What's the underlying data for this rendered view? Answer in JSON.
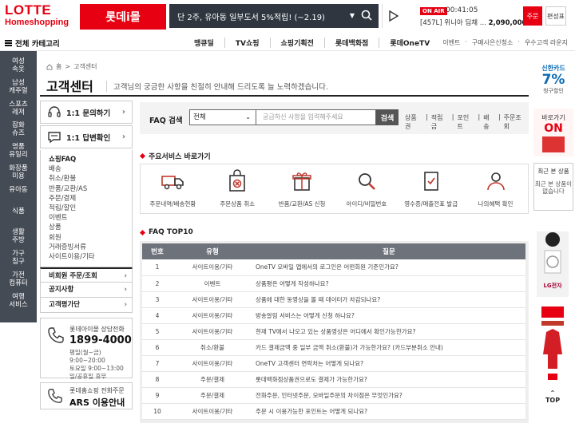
{
  "header": {
    "logo_line1": "LOTTE",
    "logo_line2": "Homeshopping",
    "mall_label": "롯데i몰",
    "promo_text": "단 2주, 유아동 일부도서 5%적립! (~2.19)",
    "onair_badge": "ON AIR",
    "onair_time": "00:41:05",
    "onair_product_prefix": "[457L] 위니아 딤채 ...",
    "onair_price": "2,090,000원",
    "order_label": "주문",
    "tv_label": "편성표"
  },
  "nav": {
    "category_all": "전체 카테고리",
    "links": [
      "맹큐딜",
      "TV쇼핑",
      "쇼핑기획전",
      "롯데백화점",
      "롯데OneTV"
    ],
    "util": [
      "이벤트",
      "·",
      "구매사은신청소",
      "·",
      "우수고객 라운지"
    ]
  },
  "sidecat": [
    "여성\n속옷",
    "남성\n캐주얼",
    "스포츠\n레저",
    "잡화\n슈즈",
    "명품\n유일리",
    "화장품\n미용",
    "유아동",
    "식품",
    "생활\n주방",
    "가구\n침구",
    "가전\n컴퓨터",
    "여행\n서비스"
  ],
  "breadcrumb": {
    "home": "홈",
    "sep": ">",
    "current": "고객센터"
  },
  "page": {
    "title": "고객센터",
    "desc": "고객님의 궁금한 사항을 친절히 안내해 드리도록 늘 노력하겠습니다."
  },
  "left_menu": {
    "inquiry": "1:1 문의하기",
    "answer": "1:1 답변확인",
    "sub_items": [
      "쇼핑FAQ",
      "배송",
      "취소/환불",
      "반품/교환/AS",
      "주문/결제",
      "적립/할인",
      "이벤트",
      "상품",
      "회원",
      "거래증빙서류",
      "사이트이용/기타"
    ],
    "rows": [
      "비회원 주문/조회",
      "공지사항",
      "고객평가단"
    ],
    "call": {
      "label": "롯데아이몰 상담전화",
      "number": "1899-4000",
      "hours1": "평일(월~금) 9:00~20:00",
      "hours2": "토요일 9:00~13:00",
      "hours3": "일/공휴일 휴무"
    },
    "ars": {
      "label": "롯데홈쇼핑 전화주문",
      "text": "ARS 이용안내"
    }
  },
  "faq_search": {
    "label": "FAQ 검색",
    "select_value": "전체",
    "placeholder": "궁금하신 사항을 입력해주세요",
    "button": "검색",
    "keywords": [
      "상품권",
      "|",
      "적립금",
      "|",
      "포인트",
      "|",
      "배송",
      "|",
      "주문조회"
    ]
  },
  "services": {
    "title": "주요서비스 바로가기",
    "items": [
      {
        "label": "주문내역/배송현황",
        "icon": "truck-icon"
      },
      {
        "label": "주문상품 취소",
        "icon": "cancel-bag-icon"
      },
      {
        "label": "반품/교환/AS 신청",
        "icon": "gift-return-icon"
      },
      {
        "label": "아이디/비밀번호",
        "icon": "search-icon"
      },
      {
        "label": "영수증/매출전표 발급",
        "icon": "receipt-icon"
      },
      {
        "label": "나의혜택 확인",
        "icon": "person-icon"
      }
    ]
  },
  "faq_top": {
    "title": "FAQ TOP10",
    "headers": [
      "번호",
      "유형",
      "질문"
    ],
    "rows": [
      [
        "1",
        "사이트이용/기타",
        "OneTV 모바일 앱에서의 로그인은 어떤회원 기준인가요?"
      ],
      [
        "2",
        "이벤트",
        "상품평은 어떻게 작성하나요?"
      ],
      [
        "3",
        "사이트이용/기타",
        "상품에 대한 동영상을 볼 때 데이터가 차감되나요?"
      ],
      [
        "4",
        "사이트이용/기타",
        "방송알림 서비스는 어떻게 신청 하나요?"
      ],
      [
        "5",
        "사이트이용/기타",
        "현재 TV에서 나오고 있는 상품영상은 어디에서 확인가능한가요?"
      ],
      [
        "6",
        "취소/환불",
        "카드 결제금액 중 일부 금액 취소(환불)가 가능한가요? (카드부분취소 안내)"
      ],
      [
        "7",
        "사이트이용/기타",
        "OneTV 고객센터 연락처는 어떻게 되나요?"
      ],
      [
        "8",
        "주문/결제",
        "롯데백화점상품권으로도 결제가 가능한가요?"
      ],
      [
        "9",
        "주문/결제",
        "전화주문, 인터넷주문, 모바일주문의 차이점은 무엇인가요?"
      ],
      [
        "10",
        "사이트이용/기타",
        "주문 시 이용가능한 포인트는 어떻게 되나요?"
      ]
    ]
  },
  "right_col": {
    "card_brand": "신한카드",
    "card_pct": "7%",
    "card_note": "청구할인",
    "barogagi": "바로가기",
    "barogagi_on": "ON",
    "recent_title": "최근 본 상품",
    "recent_empty": "최근 본 상품이 없습니다",
    "brand_lg": "LG전자",
    "top": "TOP"
  },
  "colors": {
    "brand_red": "#e60012",
    "sidebar_dark": "#454b55",
    "table_header": "#6d727b"
  }
}
